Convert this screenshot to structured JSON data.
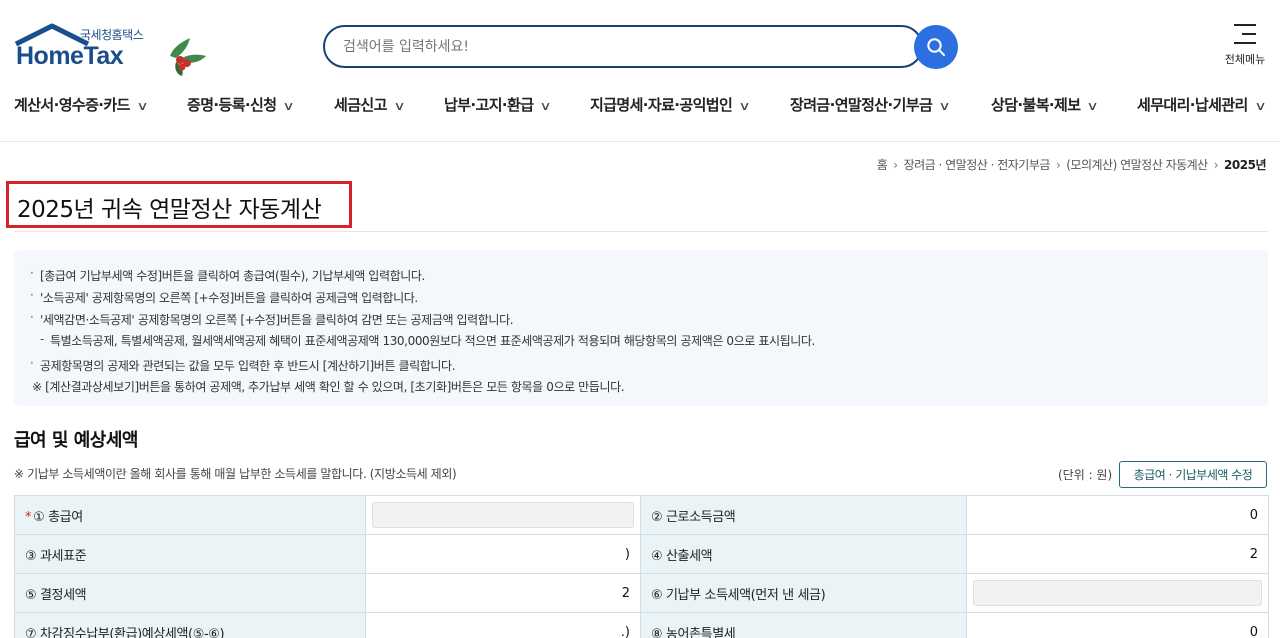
{
  "header": {
    "logo_kr": "국세청홈택스",
    "logo_en": "HomeTax",
    "search_placeholder": "검색어를 입력하세요!",
    "all_menu_label": "전체메뉴"
  },
  "gnb": {
    "items": [
      {
        "label": "계산서·영수증·카드"
      },
      {
        "label": "증명·등록·신청"
      },
      {
        "label": "세금신고"
      },
      {
        "label": "납부·고지·환급"
      },
      {
        "label": "지급명세·자료·공익법인"
      },
      {
        "label": "장려금·연말정산·기부금"
      },
      {
        "label": "상담·불복·제보"
      },
      {
        "label": "세무대리·납세관리"
      }
    ]
  },
  "breadcrumb": {
    "items": [
      "홈",
      "장려금 · 연말정산 · 전자기부금",
      "(모의계산) 연말정산 자동계산"
    ],
    "current": "2025년"
  },
  "page": {
    "title": "2025년 귀속 연말정산 자동계산"
  },
  "info": {
    "line1": "[총급여 기납부세액 수정]버튼을 클릭하여 총급여(필수), 기납부세액 입력합니다.",
    "line2": "'소득공제' 공제항목명의 오른쪽 [+수정]버튼을 클릭하여 공제금액 입력합니다.",
    "line3": "'세액감면·소득공제' 공제항목명의 오른쪽 [+수정]버튼을 클릭하여 감면 또는 공제금액 입력합니다.",
    "line4": "특별소득공제, 특별세액공제, 월세액세액공제 혜택이 표준세액공제액 130,000원보다 적으면 표준세액공제가 적용되며 해당항목의 공제액은 0으로 표시됩니다.",
    "line5": "공제항목명의 공제와 관련되는 값을 모두 입력한 후 반드시 [계산하기]버튼 클릭합니다.",
    "line6": "※ [계산결과상세보기]버튼을 통하여 공제액, 추가납부 세액 확인 할 수 있으며, [초기화]버튼은 모든 항목을 0으로 만듭니다."
  },
  "section": {
    "title": "급여 및 예상세액",
    "note": "※ 기납부 소득세액이란 올해 회사를 통해 매월 납부한 소득세를 말합니다. (지방소득세 제외)",
    "unit": "(단위 : 원)",
    "edit_button": "총급여 · 기납부세액 수정"
  },
  "table": {
    "rows": [
      {
        "l1": "① 총급여",
        "v1": "",
        "l2": "② 근로소득금액",
        "v2": "0"
      },
      {
        "l1": "③ 과세표준",
        "v1": ")",
        "l2": "④ 산출세액",
        "v2": "2"
      },
      {
        "l1": "⑤ 결정세액",
        "v1": "2",
        "l2": "⑥ 기납부 소득세액(먼저 낸 세금)",
        "v2": ""
      },
      {
        "l1": "⑦ 차감징수납부(환급)예상세액(⑤-⑥)",
        "v1": ".)",
        "l2": "⑧ 농어촌특별세",
        "v2": "0"
      }
    ],
    "required_mark": "*"
  },
  "colors": {
    "brand_navy": "#1a4d8c",
    "search_button": "#2b6fe0",
    "highlight_red": "#d4242b",
    "label_cell_bg": "#eaf4f6"
  }
}
